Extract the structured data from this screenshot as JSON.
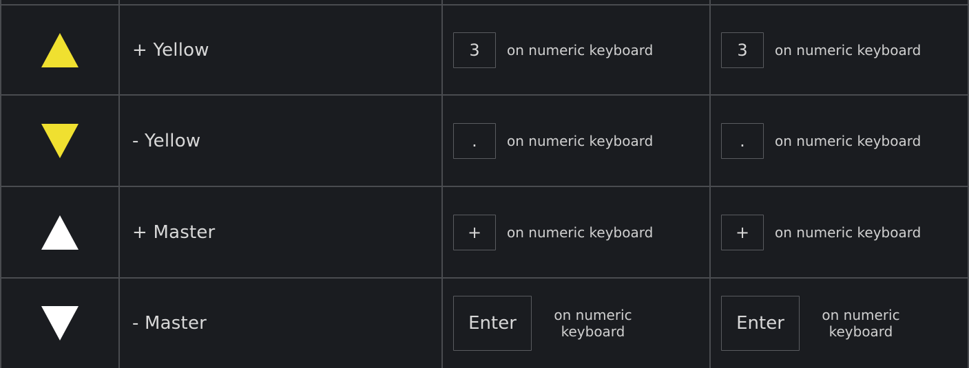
{
  "colors": {
    "background": "#1a1c20",
    "grid_line": "#4a4c50",
    "yellow": "#f0e030",
    "white": "#ffffff"
  },
  "rows": [
    {
      "icon": "triangle-up-icon",
      "icon_color": "#f0e030",
      "label": "+ Yellow",
      "key1": "3",
      "hint1": "on numeric keyboard",
      "key2": "3",
      "hint2": "on numeric keyboard"
    },
    {
      "icon": "triangle-down-icon",
      "icon_color": "#f0e030",
      "label": "- Yellow",
      "key1": ".",
      "hint1": "on numeric keyboard",
      "key2": ".",
      "hint2": "on numeric keyboard"
    },
    {
      "icon": "triangle-up-icon",
      "icon_color": "#ffffff",
      "label": "+ Master",
      "key1": "+",
      "hint1": "on numeric keyboard",
      "key2": "+",
      "hint2": "on numeric keyboard"
    },
    {
      "icon": "triangle-down-icon",
      "icon_color": "#ffffff",
      "label": "- Master",
      "key1": "Enter",
      "hint1": "on numeric keyboard",
      "key2": "Enter",
      "hint2": "on numeric keyboard"
    }
  ]
}
